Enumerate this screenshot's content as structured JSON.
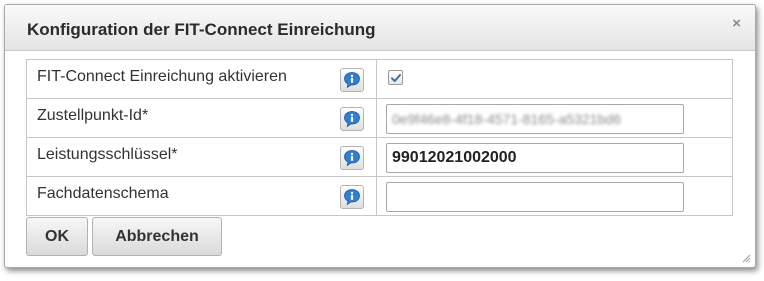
{
  "dialog": {
    "title": "Konfiguration der FIT-Connect Einreichung",
    "close_symbol": "×"
  },
  "fields": [
    {
      "label": "FIT-Connect Einreichung aktivieren",
      "type": "checkbox",
      "checked": true
    },
    {
      "label": "Zustellpunkt-Id*",
      "type": "text",
      "value": "0e9f46e8-4f18-4571-8165-a5321bd6",
      "obscured": true
    },
    {
      "label": "Leistungsschlüssel*",
      "type": "text",
      "value": "99012021002000"
    },
    {
      "label": "Fachdatenschema",
      "type": "text",
      "value": ""
    }
  ],
  "buttons": {
    "ok_label": "OK",
    "cancel_label": "Abbrechen"
  },
  "icons": {
    "info": "info-speech-bubble-icon",
    "close": "close-icon",
    "check": "checkmark-icon",
    "resize": "resize-grip-icon"
  },
  "colors": {
    "info_icon": "#2f7fd0",
    "checkmark": "#3a6ea5"
  }
}
